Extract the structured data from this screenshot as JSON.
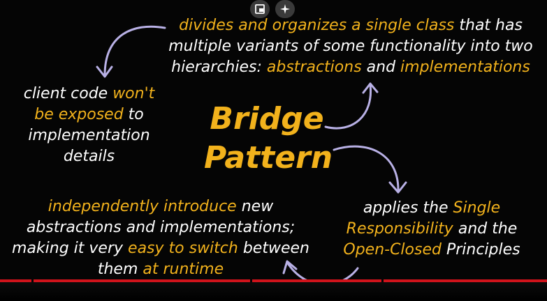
{
  "colors": {
    "accent": "#f2b21c",
    "text": "#ffffff",
    "arrow": "#b9b1e6",
    "background": "#050505",
    "progress": "#d0131b"
  },
  "toolbar": {
    "picture_in_picture_icon": "picture-in-picture-icon",
    "sparkle_icon": "sparkle-icon"
  },
  "title": {
    "line1": "Bridge",
    "line2": "Pattern"
  },
  "definition": {
    "line1_accent": "divides and organizes a single class",
    "line1_rest": " that has",
    "line2": "multiple variants of some functionality into two",
    "line3_start": "hierarchies: ",
    "line3_accent1": "abstractions",
    "line3_mid": " and ",
    "line3_accent2": "implementations"
  },
  "client": {
    "line1_start": "client code ",
    "line1_accent": "won't",
    "line2_accent": "be exposed",
    "line2_rest": " to",
    "line3": "implementation",
    "line4": "details"
  },
  "independent": {
    "line1_accent": "independently introduce",
    "line1_rest": " new",
    "line2": "abstractions and implementations;",
    "line3_start": "making it very ",
    "line3_accent": "easy to switch",
    "line3_rest": " between",
    "line4_start": "them ",
    "line4_accent": "at runtime"
  },
  "principles": {
    "line1_start": "applies the ",
    "line1_accent": "Single",
    "line2_accent": "Responsibility",
    "line2_rest": " and the",
    "line3_accent": "Open-Closed",
    "line3_rest": " Principles"
  }
}
